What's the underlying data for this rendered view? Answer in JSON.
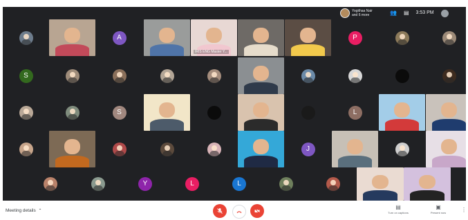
{
  "topbar": {
    "presenter_line1": "Yogithaa Nair",
    "presenter_line2": "and 6 more",
    "clock": "3:53 PM"
  },
  "grid": {
    "tiles": [
      {
        "kind": "photo",
        "color": "#6d7c8c"
      },
      {
        "kind": "video",
        "color": "#b8a592",
        "shirt": "#c24a5a"
      },
      {
        "kind": "letter",
        "text": "A",
        "color": "#7e57c2"
      },
      {
        "kind": "video",
        "color": "#9a9c9b",
        "shirt": "#4f74a8"
      },
      {
        "kind": "video",
        "color": "#e8d8d4",
        "shirt": "#f1c7cf",
        "label": "IRIS ENG Master Y..."
      },
      {
        "kind": "video",
        "color": "#6e6a66",
        "shirt": "#e6dccb"
      },
      {
        "kind": "video",
        "color": "#5b4d44",
        "shirt": "#f2c94c"
      },
      {
        "kind": "letter",
        "text": "P",
        "color": "#e91e63"
      },
      {
        "kind": "photo",
        "color": "#8c7a5a"
      },
      {
        "kind": "photo",
        "color": "#9c8a78"
      },
      {
        "kind": "letter",
        "text": "S",
        "color": "#33691e"
      },
      {
        "kind": "photo",
        "color": "#9e8c7a"
      },
      {
        "kind": "photo",
        "color": "#8a6f5a"
      },
      {
        "kind": "photo",
        "color": "#b2a596"
      },
      {
        "kind": "photo",
        "color": "#a58d7d"
      },
      {
        "kind": "video",
        "color": "#8b8f92",
        "shirt": "#2f3a4a"
      },
      {
        "kind": "photo",
        "color": "#6b8aa8"
      },
      {
        "kind": "photo",
        "color": "#d8d8d8"
      },
      {
        "kind": "blank",
        "color": "#0b0b0b"
      },
      {
        "kind": "photo",
        "color": "#3d2b1f"
      },
      {
        "kind": "photo",
        "color": "#b9a897"
      },
      {
        "kind": "photo",
        "color": "#7f8c7d"
      },
      {
        "kind": "letter",
        "text": "S",
        "color": "#a1887f"
      },
      {
        "kind": "video",
        "color": "#f2e6c8",
        "shirt": "#4d5b6a"
      },
      {
        "kind": "blank",
        "color": "#0b0b0b"
      },
      {
        "kind": "video",
        "color": "#d9c3ae",
        "shirt": "#2b2b2b"
      },
      {
        "kind": "blank",
        "color": "#1a1a1a"
      },
      {
        "kind": "letter",
        "text": "L",
        "color": "#8d6e63"
      },
      {
        "kind": "video",
        "color": "#a3cde8",
        "shirt": "#d33a3a"
      },
      {
        "kind": "video",
        "color": "#c9c2bb",
        "shirt": "#1f3c6e"
      },
      {
        "kind": "photo",
        "color": "#c7a58b"
      },
      {
        "kind": "video",
        "color": "#7d6a55",
        "shirt": "#c2691f"
      },
      {
        "kind": "photo",
        "color": "#b04a4a"
      },
      {
        "kind": "photo",
        "color": "#5c4a3c"
      },
      {
        "kind": "photo",
        "color": "#d9b4b8"
      },
      {
        "kind": "video",
        "color": "#34a8d8",
        "shirt": "#1f2a44"
      },
      {
        "kind": "letter",
        "text": "J",
        "color": "#7e57c2"
      },
      {
        "kind": "video",
        "color": "#c7c0b6",
        "shirt": "#5a6f7d"
      },
      {
        "kind": "photo",
        "color": "#cfcfcf"
      },
      {
        "kind": "video",
        "color": "#e7dfe6",
        "shirt": "#c8a7c9"
      },
      {
        "kind": "photo",
        "color": "#b9826a"
      },
      {
        "kind": "photo",
        "color": "#8a9a8f"
      },
      {
        "kind": "letter",
        "text": "Y",
        "color": "#8e24aa"
      },
      {
        "kind": "letter",
        "text": "L",
        "color": "#e91e63"
      },
      {
        "kind": "letter",
        "text": "L",
        "color": "#1976d2"
      },
      {
        "kind": "photo",
        "color": "#6e7f5c"
      },
      {
        "kind": "photo",
        "color": "#b3594a"
      },
      {
        "kind": "video",
        "color": "#eadbd2",
        "shirt": "#253a5e"
      },
      {
        "kind": "video",
        "color": "#d4c1de",
        "shirt": "#232323"
      }
    ]
  },
  "bottombar": {
    "meeting_details": "Meeting details",
    "turn_on_captions": "Turn on captions",
    "present_now": "Present now"
  },
  "colors": {
    "background": "#202124",
    "end_call": "#ea4335"
  }
}
